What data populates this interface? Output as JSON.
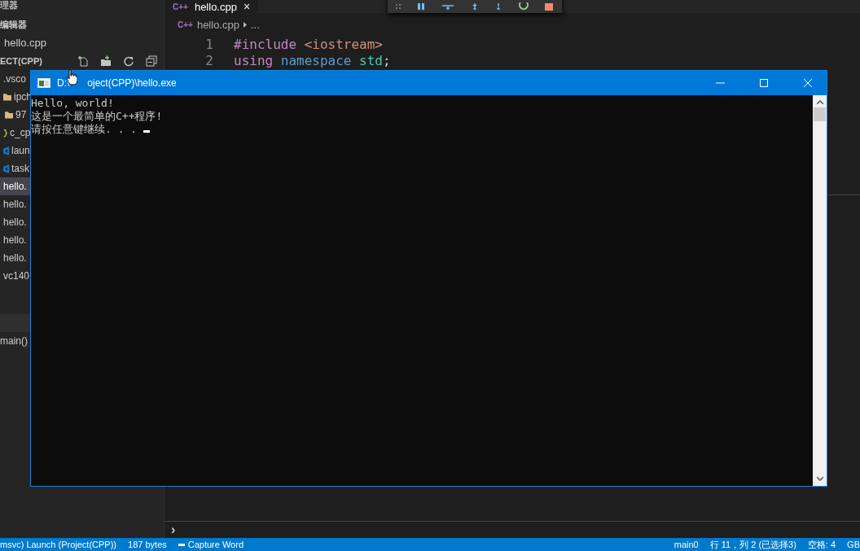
{
  "sidebar": {
    "title": "理器",
    "open_editors": {
      "title": "编辑器",
      "items": [
        "hello.cpp"
      ]
    },
    "project": {
      "title": "ECT(CPP)"
    },
    "files": [
      {
        "name": ".vsco",
        "kind": "none",
        "selected": false
      },
      {
        "name": "ipch",
        "kind": "folder",
        "selected": false
      },
      {
        "name": "97",
        "kind": "folder-indent",
        "selected": false
      },
      {
        "name": "c_cp",
        "kind": "json",
        "selected": false
      },
      {
        "name": "laun",
        "kind": "vs",
        "selected": false
      },
      {
        "name": "task",
        "kind": "vs",
        "selected": false
      },
      {
        "name": "hello.",
        "kind": "none",
        "selected": true
      },
      {
        "name": "hello.",
        "kind": "none",
        "selected": false
      },
      {
        "name": "hello.",
        "kind": "none",
        "selected": false
      },
      {
        "name": "hello.",
        "kind": "none",
        "selected": false
      },
      {
        "name": "hello.",
        "kind": "none",
        "selected": false
      },
      {
        "name": "vc140",
        "kind": "none",
        "selected": false
      }
    ],
    "outline": [
      "main()"
    ]
  },
  "editor": {
    "tab": {
      "icon": "C++",
      "label": "hello.cpp",
      "close": "×"
    },
    "breadcrumb": {
      "icon": "C++",
      "file": "hello.cpp",
      "more": "..."
    },
    "lines": [
      {
        "number": "1",
        "tokens": [
          {
            "text": "#include",
            "kind": "keyword"
          },
          {
            "text": "<iostream>",
            "kind": "string"
          }
        ]
      },
      {
        "number": "2",
        "tokens": [
          {
            "text": "using",
            "kind": "keyword"
          },
          {
            "text": "namespace",
            "kind": "type"
          },
          {
            "text": "std",
            "kind": "ns"
          },
          {
            "text": ";",
            "kind": "punct"
          }
        ]
      }
    ]
  },
  "terminal": {
    "prompt": "›"
  },
  "console": {
    "title_parts": [
      "D:\\",
      "oject(CPP)\\hello.exe"
    ],
    "lines": [
      "Hello, world!",
      "这是一个最简单的C++程序!",
      "请按任意键继续. . . "
    ]
  },
  "status_bar": {
    "left": [
      "msvc) Launch (Project(CPP))",
      "187 bytes",
      "Capture Word"
    ],
    "right": [
      "main0",
      "行 11，列 2 (已选择3)",
      "空格: 4",
      "GB"
    ]
  }
}
